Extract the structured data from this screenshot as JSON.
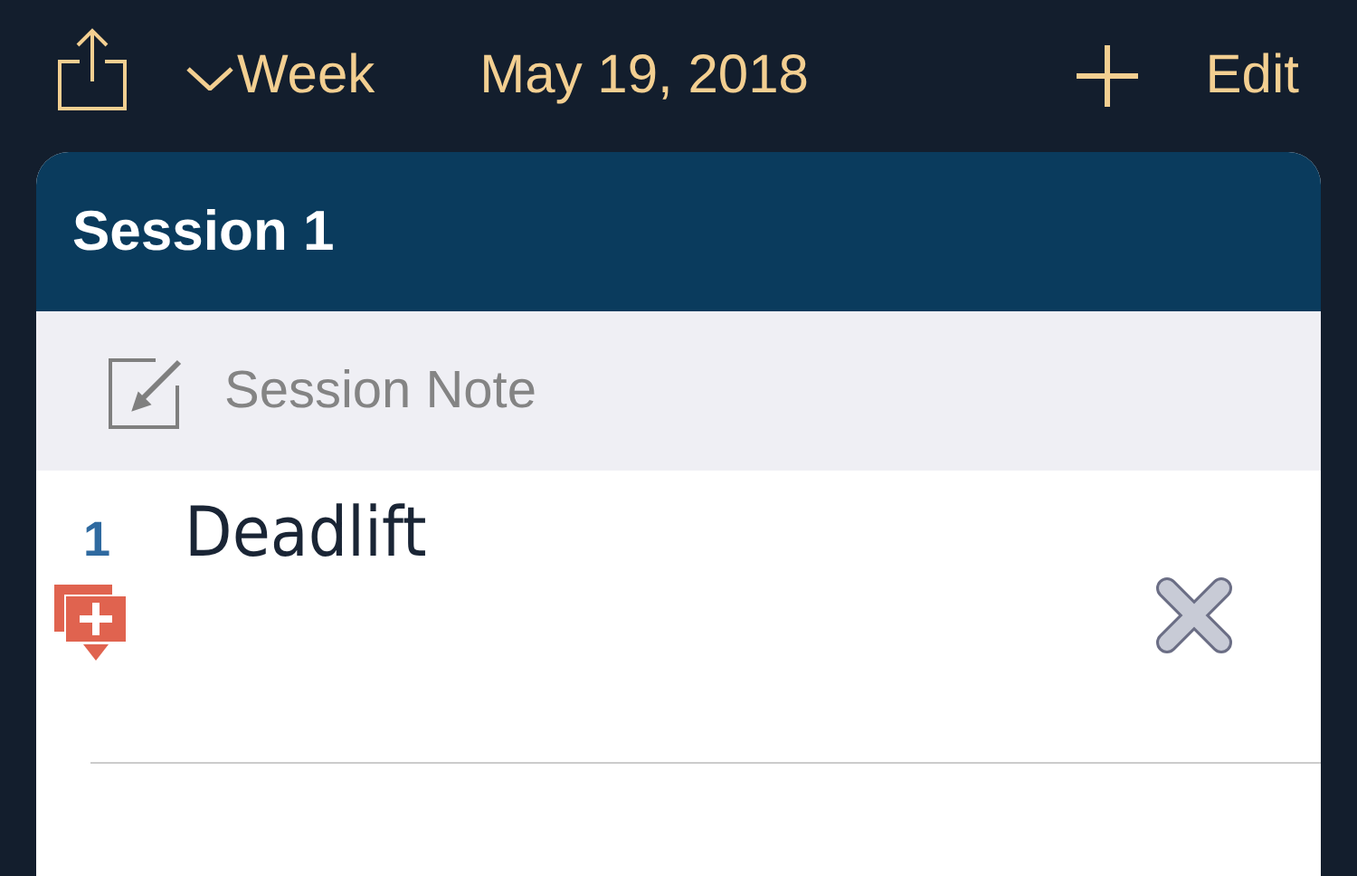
{
  "toolbar": {
    "view": "Week",
    "date": "May 19, 2018",
    "edit": "Edit"
  },
  "session": {
    "title": "Session 1",
    "note_placeholder": "Session Note",
    "exercises": [
      {
        "number": "1",
        "name": "Deadlift"
      }
    ]
  }
}
